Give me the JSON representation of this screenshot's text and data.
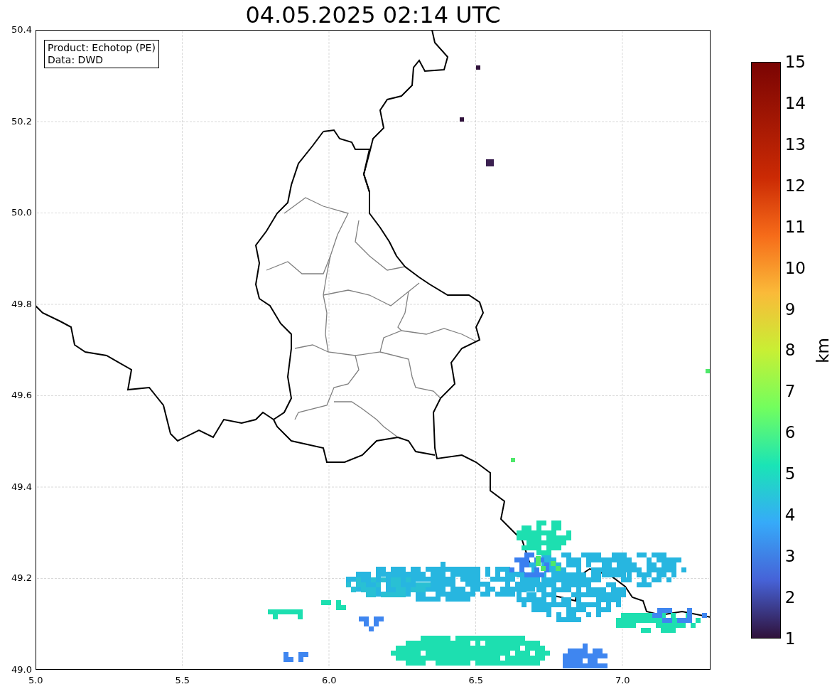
{
  "title": "04.05.2025 02:14 UTC",
  "info_box": {
    "lines": [
      "Product: Echotop (PE)",
      "Data: DWD"
    ]
  },
  "y_axis": {
    "ticks": [
      "50.4",
      "50.2",
      "50.0",
      "49.8",
      "49.6",
      "49.4",
      "49.2",
      "49.0"
    ]
  },
  "x_axis": {
    "ticks": [
      "5.0",
      "5.5",
      "6.0",
      "6.5",
      "7.0"
    ]
  },
  "colorbar": {
    "label": "km",
    "ticks": [
      "15",
      "14",
      "13",
      "12",
      "11",
      "10",
      "9",
      "8",
      "7",
      "6",
      "5",
      "4",
      "3",
      "2",
      "1"
    ]
  }
}
